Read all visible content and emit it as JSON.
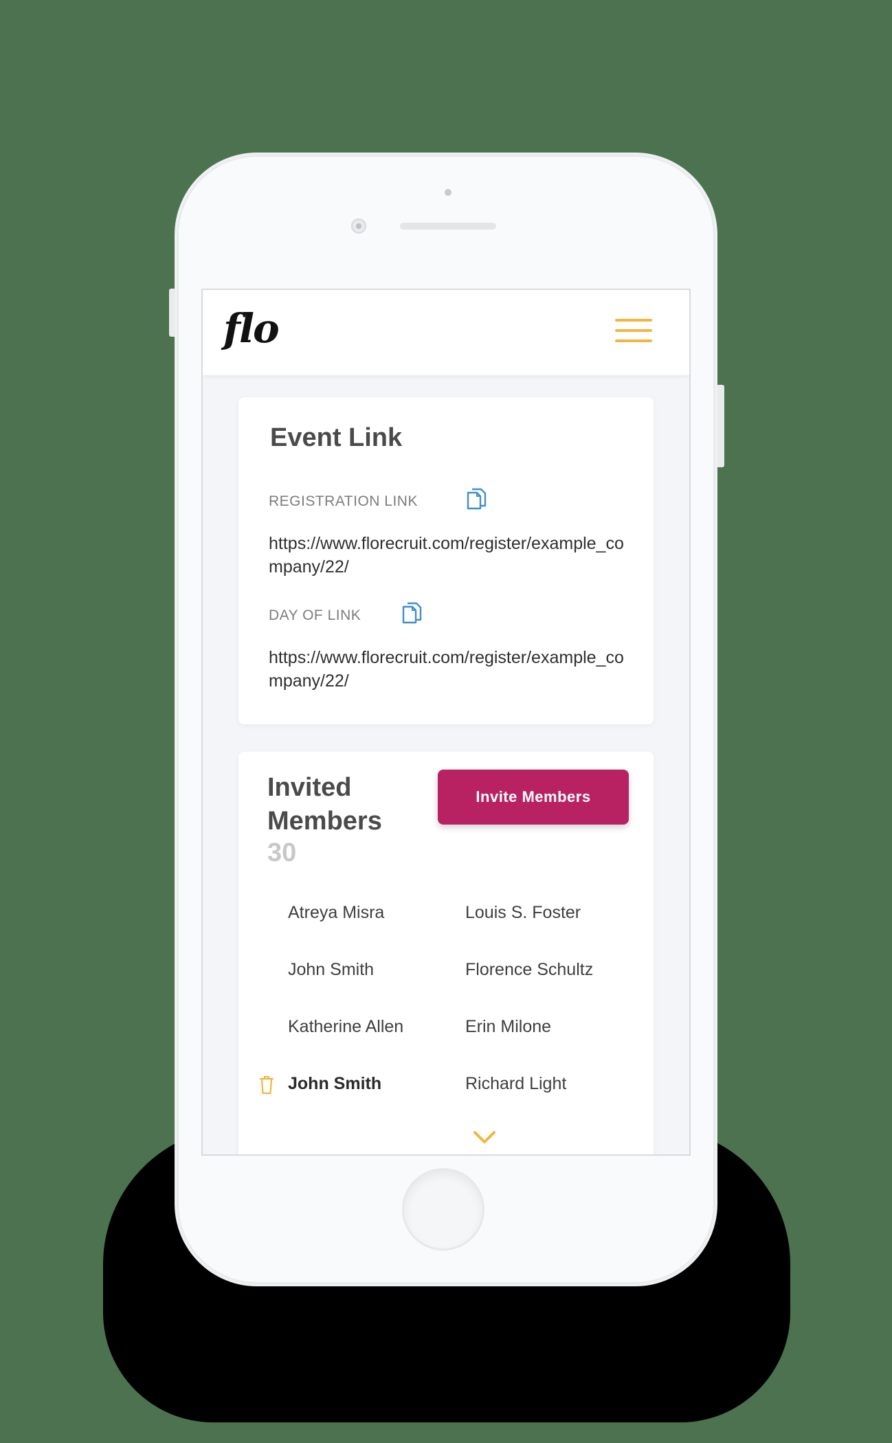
{
  "header": {
    "logo_text": "flo",
    "menu_icon": "hamburger-icon",
    "accent_color": "#f2b63d"
  },
  "event_link": {
    "title": "Event Link",
    "registration": {
      "label": "REGISTRATION LINK",
      "url": "https://www.florecruit.com/register/example_company/22/",
      "icon": "copy-icon"
    },
    "day_of": {
      "label": "DAY OF LINK",
      "url": "https://www.florecruit.com/register/example_company/22/",
      "icon": "copy-icon"
    },
    "icon_color": "#3f8fc8"
  },
  "invited": {
    "title_line1": "Invited",
    "title_line2": "Members",
    "count": "30",
    "invite_button_label": "Invite Members",
    "button_color": "#b82263",
    "members_left": [
      "Atreya Misra",
      "John Smith",
      "Katherine Allen",
      "John Smith"
    ],
    "members_right": [
      "Louis S. Foster",
      "Florence Schultz",
      "Erin Milone",
      "Richard Light"
    ],
    "selected_member_icon": "trash-icon",
    "more_icon": "chevron-down-icon"
  }
}
